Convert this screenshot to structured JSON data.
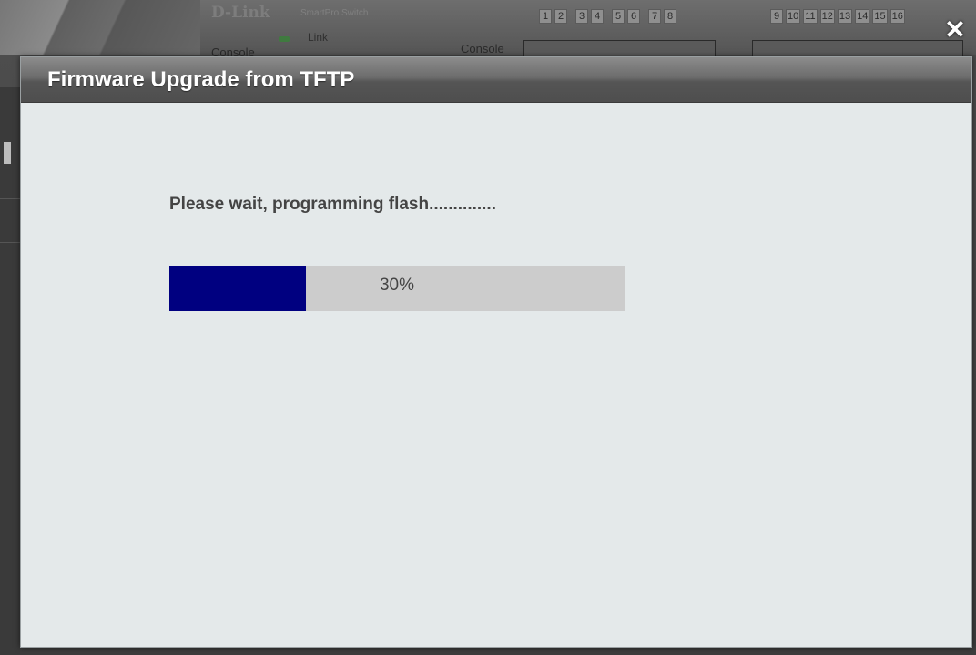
{
  "background": {
    "brand": "D-Link",
    "subbrand": "SmartPro Switch",
    "console_left": "Console",
    "link_label": "Link",
    "console_right": "Console",
    "ports_group_1": [
      "1",
      "2",
      "3",
      "4",
      "5",
      "6",
      "7",
      "8"
    ],
    "ports_group_2": [
      "9",
      "10",
      "11",
      "12",
      "13",
      "14",
      "15",
      "16"
    ]
  },
  "dialog": {
    "title": "Firmware Upgrade from TFTP",
    "close_icon": "close-icon",
    "status_message": "Please wait, programming flash..............",
    "progress": {
      "percent": 30,
      "label": "30%",
      "fill_color": "#000080",
      "track_color": "#cccccc"
    }
  }
}
